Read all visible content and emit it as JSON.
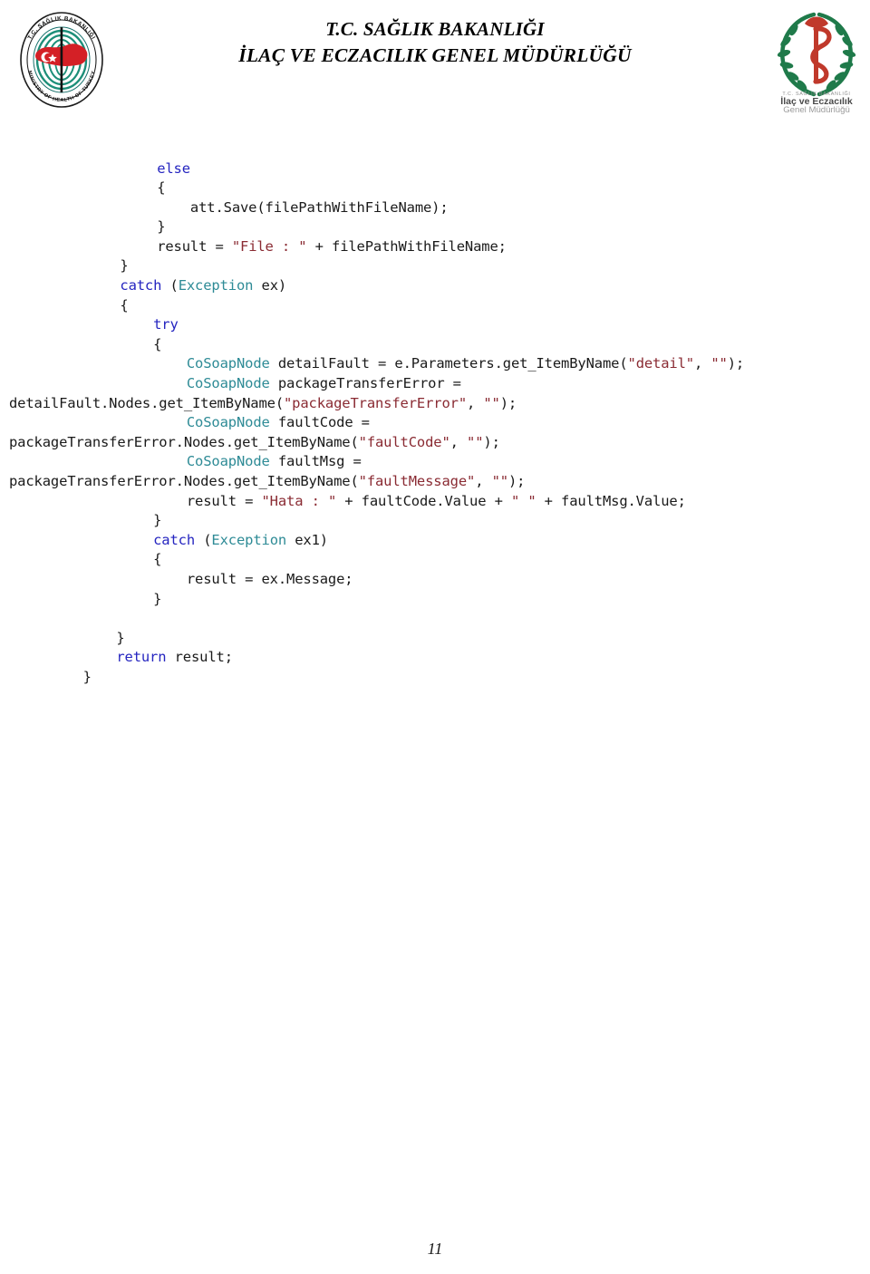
{
  "header": {
    "title_line1": "T.C. SAĞLIK BAKANLIĞI",
    "title_line2": "İLAÇ VE ECZACILIK GENEL MÜDÜRLÜĞÜ",
    "left_logo": {
      "name": "ministry-of-health-seal",
      "ring_text_top": "T.C. SAĞLIK BAKANLIĞI",
      "ring_text_bottom": "THE MINISTRY OF HEALTH OF TURKEY"
    },
    "right_logo": {
      "name": "ilac-eczacilik-logo",
      "caption_small": "T.C. SAĞLIK BAKANLIĞI",
      "caption_line1": "İlaç ve Eczacılık",
      "caption_line2": "Genel Müdürlüğü"
    }
  },
  "colors": {
    "keyword": "#2525c0",
    "type": "#2e8b96",
    "string": "#8a2b33",
    "plain": "#1a1a1a",
    "page_background": "#ffffff"
  },
  "code": {
    "language": "csharp",
    "lines": [
      {
        "indent": 16,
        "tokens": [
          {
            "t": "kw",
            "v": "else"
          }
        ]
      },
      {
        "indent": 16,
        "tokens": [
          {
            "t": "plain",
            "v": "{"
          }
        ]
      },
      {
        "indent": 16,
        "tokens": [
          {
            "t": "plain",
            "v": "    att.Save(filePathWithFileName);"
          }
        ]
      },
      {
        "indent": 16,
        "tokens": [
          {
            "t": "plain",
            "v": "}"
          }
        ]
      },
      {
        "indent": 16,
        "tokens": [
          {
            "t": "plain",
            "v": "result = "
          },
          {
            "t": "str",
            "v": "\"File : \""
          },
          {
            "t": "plain",
            "v": " + filePathWithFileName;"
          }
        ]
      },
      {
        "indent": 12,
        "tokens": [
          {
            "t": "plain",
            "v": "}"
          }
        ]
      },
      {
        "indent": 12,
        "tokens": [
          {
            "t": "kw",
            "v": "catch"
          },
          {
            "t": "plain",
            "v": " ("
          },
          {
            "t": "type",
            "v": "Exception"
          },
          {
            "t": "plain",
            "v": " ex)"
          }
        ]
      },
      {
        "indent": 12,
        "tokens": [
          {
            "t": "plain",
            "v": "{"
          }
        ]
      },
      {
        "indent": 12,
        "tokens": [
          {
            "t": "plain",
            "v": "    "
          },
          {
            "t": "kw",
            "v": "try"
          }
        ]
      },
      {
        "indent": 12,
        "tokens": [
          {
            "t": "plain",
            "v": "    {"
          }
        ]
      },
      {
        "indent": 12,
        "tokens": [
          {
            "t": "plain",
            "v": "        "
          },
          {
            "t": "type",
            "v": "CoSoapNode"
          },
          {
            "t": "plain",
            "v": " detailFault = e.Parameters.get_ItemByName("
          },
          {
            "t": "str",
            "v": "\"detail\""
          },
          {
            "t": "plain",
            "v": ", "
          },
          {
            "t": "str",
            "v": "\"\""
          },
          {
            "t": "plain",
            "v": ");"
          }
        ]
      },
      {
        "indent": 12,
        "tokens": [
          {
            "t": "plain",
            "v": "        "
          },
          {
            "t": "type",
            "v": "CoSoapNode"
          },
          {
            "t": "plain",
            "v": " packageTransferError ="
          }
        ]
      },
      {
        "indent": 0,
        "tokens": [
          {
            "t": "plain",
            "v": "detailFault.Nodes.get_ItemByName("
          },
          {
            "t": "str",
            "v": "\"packageTransferError\""
          },
          {
            "t": "plain",
            "v": ", "
          },
          {
            "t": "str",
            "v": "\"\""
          },
          {
            "t": "plain",
            "v": ");"
          }
        ]
      },
      {
        "indent": 12,
        "tokens": [
          {
            "t": "plain",
            "v": "        "
          },
          {
            "t": "type",
            "v": "CoSoapNode"
          },
          {
            "t": "plain",
            "v": " faultCode ="
          }
        ]
      },
      {
        "indent": 0,
        "tokens": [
          {
            "t": "plain",
            "v": "packageTransferError.Nodes.get_ItemByName("
          },
          {
            "t": "str",
            "v": "\"faultCode\""
          },
          {
            "t": "plain",
            "v": ", "
          },
          {
            "t": "str",
            "v": "\"\""
          },
          {
            "t": "plain",
            "v": ");"
          }
        ]
      },
      {
        "indent": 12,
        "tokens": [
          {
            "t": "plain",
            "v": "        "
          },
          {
            "t": "type",
            "v": "CoSoapNode"
          },
          {
            "t": "plain",
            "v": " faultMsg ="
          }
        ]
      },
      {
        "indent": 0,
        "tokens": [
          {
            "t": "plain",
            "v": "packageTransferError.Nodes.get_ItemByName("
          },
          {
            "t": "str",
            "v": "\"faultMessage\""
          },
          {
            "t": "plain",
            "v": ", "
          },
          {
            "t": "str",
            "v": "\"\""
          },
          {
            "t": "plain",
            "v": ");"
          }
        ]
      },
      {
        "indent": 12,
        "tokens": [
          {
            "t": "plain",
            "v": "        result = "
          },
          {
            "t": "str",
            "v": "\"Hata : \""
          },
          {
            "t": "plain",
            "v": " + faultCode.Value + "
          },
          {
            "t": "str",
            "v": "\" \""
          },
          {
            "t": "plain",
            "v": " + faultMsg.Value;"
          }
        ]
      },
      {
        "indent": 12,
        "tokens": [
          {
            "t": "plain",
            "v": "    }"
          }
        ]
      },
      {
        "indent": 12,
        "tokens": [
          {
            "t": "plain",
            "v": "    "
          },
          {
            "t": "kw",
            "v": "catch"
          },
          {
            "t": "plain",
            "v": " ("
          },
          {
            "t": "type",
            "v": "Exception"
          },
          {
            "t": "plain",
            "v": " ex1)"
          }
        ]
      },
      {
        "indent": 12,
        "tokens": [
          {
            "t": "plain",
            "v": "    {"
          }
        ]
      },
      {
        "indent": 12,
        "tokens": [
          {
            "t": "plain",
            "v": "        result = ex.Message;"
          }
        ]
      },
      {
        "indent": 12,
        "tokens": [
          {
            "t": "plain",
            "v": "    }"
          }
        ]
      },
      {
        "indent": 0,
        "tokens": []
      },
      {
        "indent": 8,
        "tokens": [
          {
            "t": "plain",
            "v": "    }"
          }
        ]
      },
      {
        "indent": 8,
        "tokens": [
          {
            "t": "plain",
            "v": "    "
          },
          {
            "t": "kw",
            "v": "return"
          },
          {
            "t": "plain",
            "v": " result;"
          }
        ]
      },
      {
        "indent": 8,
        "tokens": [
          {
            "t": "plain",
            "v": "}"
          }
        ]
      }
    ]
  },
  "footer": {
    "page_number": "11"
  }
}
